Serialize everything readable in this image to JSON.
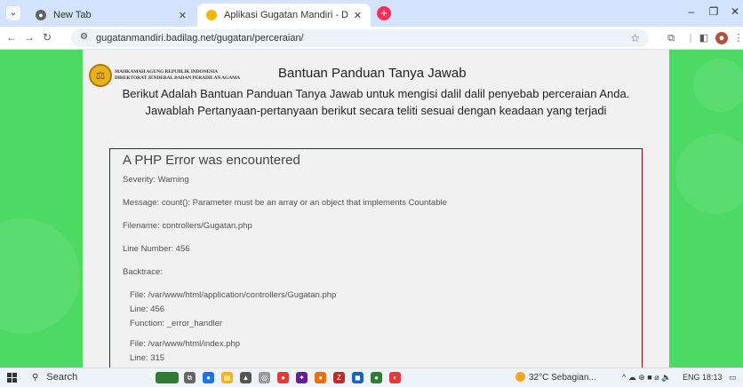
{
  "browser": {
    "tabs": [
      {
        "label": "New Tab",
        "favicon": "chrome-icon"
      },
      {
        "label": "Aplikasi Gugatan Mandiri - Dir",
        "favicon": "site-logo-icon",
        "active": true
      }
    ],
    "new_tab_label": "+",
    "url": "gugatanmandiri.badilag.net/gugatan/perceraian/"
  },
  "page": {
    "org_line1": "MAHKAMAH AGUNG REPUBLIK INDONESIA",
    "org_line2": "DIREKTORAT JENDERAL BADAN PERADILAN AGAMA",
    "title": "Bantuan Panduan Tanya Jawab",
    "subtitle1": "Berikut Adalah Bantuan Panduan Tanya Jawab untuk mengisi dalil dalil penyebab perceraian Anda.",
    "subtitle2": "Jawablah Pertanyaan-pertanyaan berikut secara teliti sesuai dengan keadaan yang terjadi"
  },
  "error": {
    "heading": "A PHP Error was encountered",
    "severity": "Severity: Warning",
    "message": "Message: count(): Parameter must be an array or an object that implements Countable",
    "filename": "Filename: controllers/Gugatan.php",
    "line_number": "Line Number: 456",
    "backtrace_label": "Backtrace:",
    "backtrace": [
      {
        "file": "File: /var/www/html/application/controllers/Gugatan.php",
        "line": "Line: 456",
        "function": "Function: _error_handler"
      },
      {
        "file": "File: /var/www/html/index.php",
        "line": "Line: 315"
      }
    ]
  },
  "taskbar": {
    "search_label": "Search",
    "weather": "32°C  Sebagian...",
    "language": "ENG",
    "time": "18:13"
  },
  "colors": {
    "page_bg": "#4cd964",
    "panel_bg": "#f1f1f1",
    "error_border": "#990000",
    "tabstrip": "#d3e3fd"
  }
}
